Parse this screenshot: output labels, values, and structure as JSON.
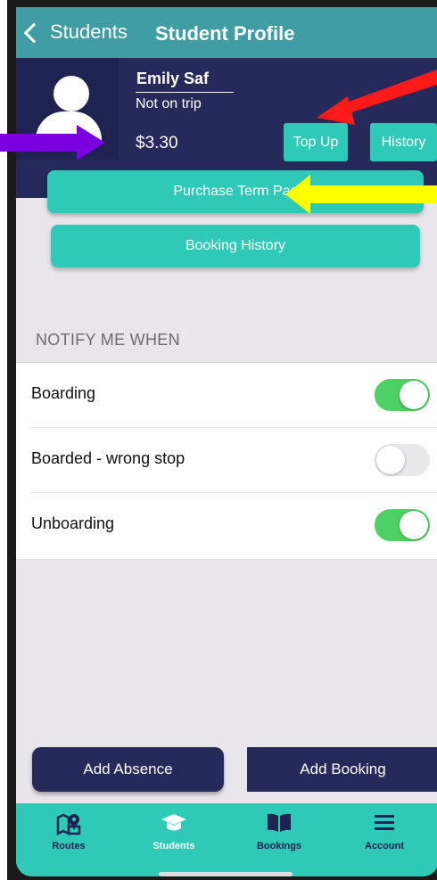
{
  "nav": {
    "back_label": "Students",
    "title": "Student Profile"
  },
  "profile": {
    "name": "Emily Saf",
    "status": "Not on trip",
    "balance": "$3.30",
    "topup_label": "Top Up",
    "history_label": "History"
  },
  "actions": {
    "purchase_label": "Purchase Term Pas",
    "booking_history_label": "Booking History"
  },
  "notify": {
    "header": "NOTIFY ME WHEN",
    "items": [
      {
        "label": "Boarding",
        "on": true
      },
      {
        "label": "Boarded - wrong stop",
        "on": false
      },
      {
        "label": "Unboarding",
        "on": true
      }
    ]
  },
  "bottom_buttons": {
    "absence_label": "Add Absence",
    "booking_label": "Add Booking"
  },
  "tabs": [
    {
      "label": "Routes",
      "icon": "map-pin-icon"
    },
    {
      "label": "Students",
      "icon": "graduation-cap-icon"
    },
    {
      "label": "Bookings",
      "icon": "book-icon"
    },
    {
      "label": "Account",
      "icon": "menu-icon"
    }
  ],
  "colors": {
    "teal": "#2ecab7",
    "navy": "#252a5a",
    "header": "#3f9da3",
    "switch_on": "#4ed164"
  }
}
